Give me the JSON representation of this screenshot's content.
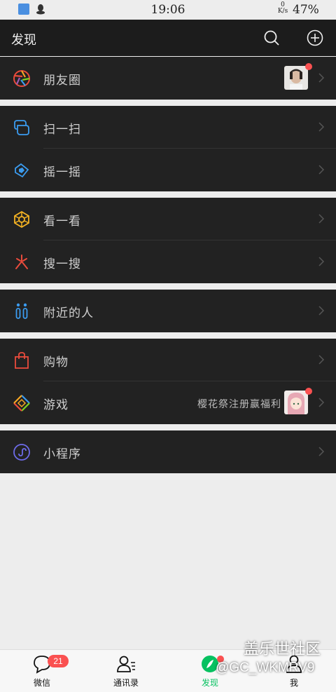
{
  "status_bar": {
    "time": "19:06",
    "net_speed_value": "0",
    "net_speed_unit": "K/s",
    "battery": "47%"
  },
  "header": {
    "title": "发现"
  },
  "items": {
    "moments": {
      "label": "朋友圈"
    },
    "scan": {
      "label": "扫一扫"
    },
    "shake": {
      "label": "摇一摇"
    },
    "top_stories": {
      "label": "看一看"
    },
    "search": {
      "label": "搜一搜"
    },
    "nearby": {
      "label": "附近的人"
    },
    "shopping": {
      "label": "购物"
    },
    "games": {
      "label": "游戏",
      "subtitle": "樱花祭注册赢福利"
    },
    "mini_programs": {
      "label": "小程序"
    }
  },
  "tabs": {
    "chats": {
      "label": "微信",
      "badge": "21"
    },
    "contacts": {
      "label": "通讯录"
    },
    "discover": {
      "label": "发现"
    },
    "me": {
      "label": "我"
    }
  },
  "watermark": {
    "line1": "盖乐世社区",
    "line2": "@GC_WKMRV9"
  },
  "colors": {
    "background": "#ededed",
    "header": "#1c1c1c",
    "row_background": "#222222",
    "accent_green": "#07c160",
    "badge_red": "#fa5151"
  },
  "icons": [
    "moments-aperture-icon",
    "scan-icon",
    "shake-icon",
    "top-stories-icon",
    "search-sparkle-icon",
    "nearby-people-icon",
    "shopping-bag-icon",
    "games-diamond-icon",
    "mini-program-icon",
    "chevron-right-icon",
    "search-icon",
    "add-icon"
  ]
}
